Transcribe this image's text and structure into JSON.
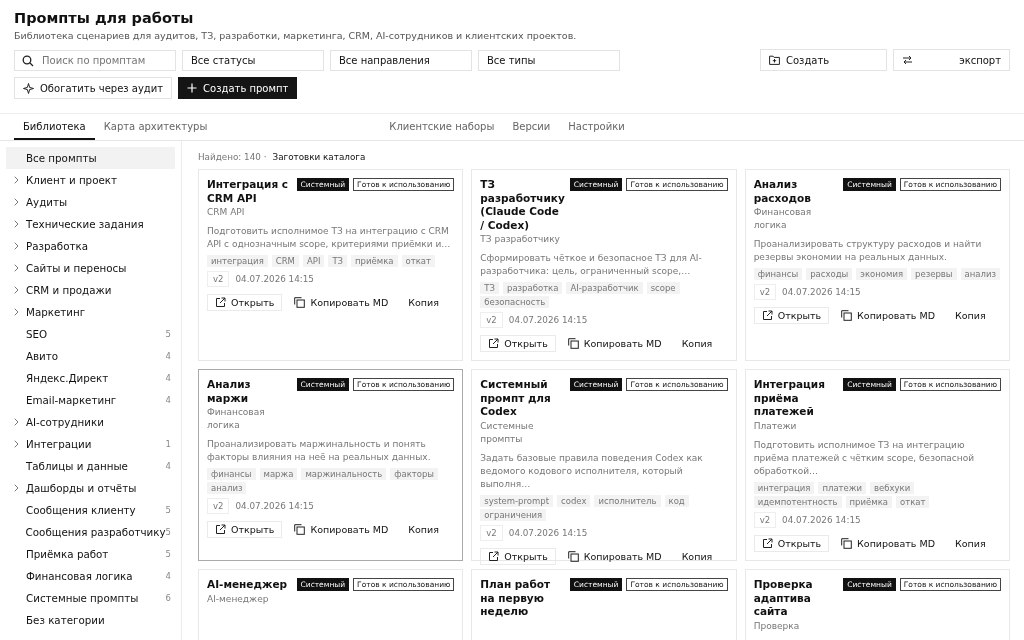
{
  "header": {
    "title": "Промпты для работы",
    "subtitle": "Библиотека сценариев для аудитов, ТЗ, разработки, маркетинга, CRM, AI-сотрудников и клиентских проектов."
  },
  "toolbar": {
    "search": {
      "placeholder": "Поиск по промптам"
    },
    "selects": [
      "Все статусы",
      "Все направления",
      "Все типы"
    ],
    "create_folder": "Создать",
    "export": "экспорт",
    "enrich": "Обогатить через аудит",
    "create_prompt": "Создать промпт"
  },
  "tabs": {
    "left": [
      {
        "label": "Библиотека",
        "selected": true
      },
      {
        "label": "Карта архитектуры",
        "selected": false
      }
    ],
    "right": [
      {
        "label": "Клиентские наборы",
        "selected": false
      },
      {
        "label": "Версии",
        "selected": false
      },
      {
        "label": "Настройки",
        "selected": false
      }
    ]
  },
  "sidebar": {
    "items": [
      {
        "label": "Все промпты",
        "selected": true,
        "expandable": false
      },
      {
        "label": "Клиент и проект",
        "selected": false,
        "expandable": true
      },
      {
        "label": "Аудиты",
        "selected": false,
        "expandable": true
      },
      {
        "label": "Технические задания",
        "selected": false,
        "expandable": true
      },
      {
        "label": "Разработка",
        "selected": false,
        "expandable": true
      },
      {
        "label": "Сайты и переносы",
        "selected": false,
        "expandable": true
      },
      {
        "label": "CRM и продажи",
        "selected": false,
        "expandable": true
      },
      {
        "label": "Маркетинг",
        "selected": false,
        "expandable": true
      },
      {
        "label": "SEO",
        "selected": false,
        "expandable": false,
        "count": "5"
      },
      {
        "label": "Авито",
        "selected": false,
        "expandable": false,
        "count": "4"
      },
      {
        "label": "Яндекс.Директ",
        "selected": false,
        "expandable": false,
        "count": "4"
      },
      {
        "label": "Email-маркетинг",
        "selected": false,
        "expandable": false,
        "count": "4"
      },
      {
        "label": "AI-сотрудники",
        "selected": false,
        "expandable": true
      },
      {
        "label": "Интеграции",
        "selected": false,
        "expandable": true,
        "count": "1"
      },
      {
        "label": "Таблицы и данные",
        "selected": false,
        "expandable": false,
        "count": "4"
      },
      {
        "label": "Дашборды и отчёты",
        "selected": false,
        "expandable": true
      },
      {
        "label": "Сообщения клиенту",
        "selected": false,
        "expandable": false,
        "count": "5"
      },
      {
        "label": "Сообщения разработчику",
        "selected": false,
        "expandable": false,
        "count": "5"
      },
      {
        "label": "Приёмка работ",
        "selected": false,
        "expandable": false,
        "count": "5"
      },
      {
        "label": "Финансовая логика",
        "selected": false,
        "expandable": false,
        "count": "4"
      },
      {
        "label": "Системные промпты",
        "selected": false,
        "expandable": false,
        "count": "6"
      },
      {
        "label": "Без категории",
        "selected": false,
        "expandable": false
      }
    ]
  },
  "results": {
    "found": "Найдено: 140 ·",
    "source": "Заготовки каталога"
  },
  "cards": [
    {
      "title": "Интеграция с CRM API",
      "category": "CRM API",
      "type": "Системный",
      "status": "Готов к использованию",
      "selected": false,
      "description": "Подготовить исполнимое ТЗ на интеграцию с CRM API с однозначным scope, критериями приёмки и…",
      "tags": [
        "интеграция",
        "CRM",
        "API",
        "ТЗ",
        "приёмка",
        "откат"
      ],
      "version": "v2",
      "date": "04.07.2026 14:15",
      "actions": [
        "Открыть",
        "Копировать MD",
        "Копия"
      ]
    },
    {
      "title": "ТЗ разработчику (Claude Code / Codex)",
      "category": "ТЗ разработчику",
      "type": "Системный",
      "status": "Готов к использованию",
      "selected": false,
      "description": "Сформировать чёткое и безопасное ТЗ для AI-разработчика: цель, ограниченный scope,…",
      "tags": [
        "ТЗ",
        "разработка",
        "AI-разработчик",
        "scope",
        "безопасность"
      ],
      "version": "v2",
      "date": "04.07.2026 14:15",
      "actions": [
        "Открыть",
        "Копировать MD",
        "Копия"
      ]
    },
    {
      "title": "Анализ расходов",
      "category": "Финансовая логика",
      "type": "Системный",
      "status": "Готов к использованию",
      "selected": false,
      "description": "Проанализировать структуру расходов и найти резервы экономии на реальных данных.",
      "tags": [
        "финансы",
        "расходы",
        "экономия",
        "резервы",
        "анализ"
      ],
      "version": "v2",
      "date": "04.07.2026 14:15",
      "actions": [
        "Открыть",
        "Копировать MD",
        "Копия"
      ]
    },
    {
      "title": "Анализ маржи",
      "category": "Финансовая логика",
      "type": "Системный",
      "status": "Готов к использованию",
      "selected": true,
      "description": "Проанализировать маржинальность и понять факторы влияния на неё на реальных данных.",
      "tags": [
        "финансы",
        "маржа",
        "маржинальность",
        "факторы",
        "анализ"
      ],
      "version": "v2",
      "date": "04.07.2026 14:15",
      "actions": [
        "Открыть",
        "Копировать MD",
        "Копия"
      ]
    },
    {
      "title": "Системный промпт для Codex",
      "category": "Системные промпты",
      "type": "Системный",
      "status": "Готов к использованию",
      "selected": false,
      "description": "Задать базовые правила поведения Codex как ведомого кодового исполнителя, который выполня…",
      "tags": [
        "system-prompt",
        "codex",
        "исполнитель",
        "код",
        "ограничения"
      ],
      "version": "v2",
      "date": "04.07.2026 14:15",
      "actions": [
        "Открыть",
        "Копировать MD",
        "Копия"
      ]
    },
    {
      "title": "Интеграция приёма платежей",
      "category": "Платежи",
      "type": "Системный",
      "status": "Готов к использованию",
      "selected": false,
      "description": "Подготовить исполнимое ТЗ на интеграцию приёма платежей с чётким scope, безопасной обработкой…",
      "tags": [
        "интеграция",
        "платежи",
        "вебхуки",
        "идемпотентность",
        "приёмка",
        "откат"
      ],
      "version": "v2",
      "date": "04.07.2026 14:15",
      "actions": [
        "Открыть",
        "Копировать MD",
        "Копия"
      ]
    },
    {
      "title": "AI-менеджер",
      "category": "AI-менеджер",
      "type": "Системный",
      "status": "Готов к использованию",
      "selected": false
    },
    {
      "title": "План работ на первую неделю",
      "type": "Системный",
      "status": "Готов к использованию",
      "selected": false
    },
    {
      "title": "Проверка адаптива сайта",
      "category": "Проверка",
      "type": "Системный",
      "status": "Готов к использованию",
      "selected": false
    }
  ]
}
